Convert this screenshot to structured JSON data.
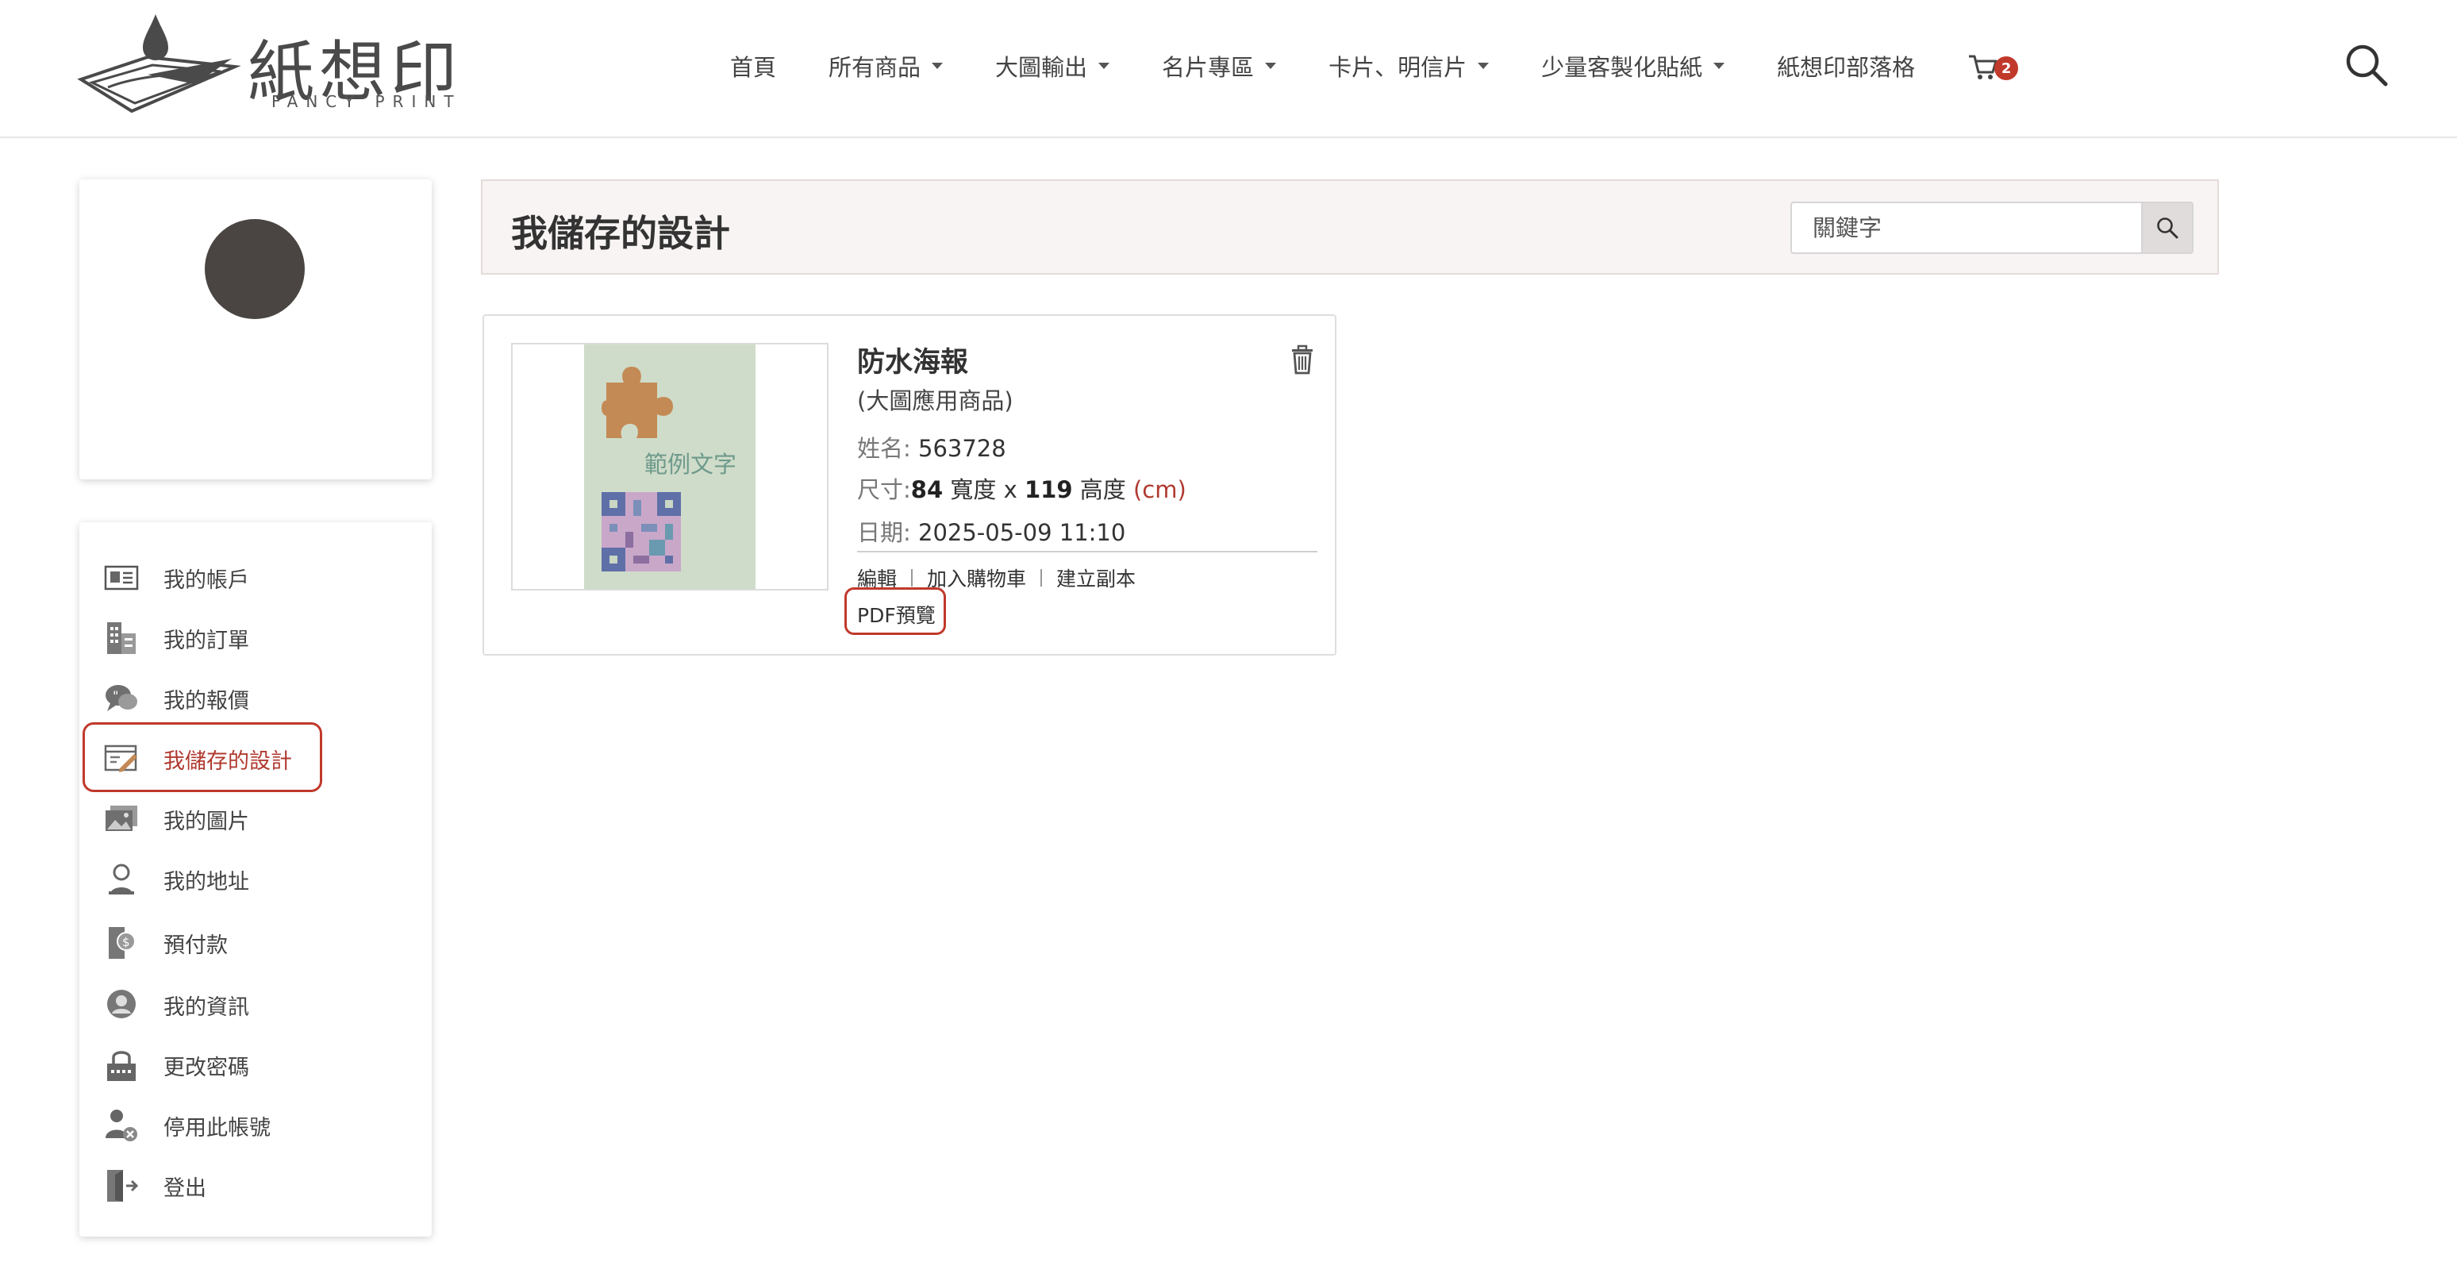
{
  "header": {
    "logo_text": "紙想印",
    "logo_sub": "FANCY PRINT",
    "nav": [
      {
        "label": "首頁",
        "has_caret": false
      },
      {
        "label": "所有商品",
        "has_caret": true
      },
      {
        "label": "大圖輸出",
        "has_caret": true
      },
      {
        "label": "名片專區",
        "has_caret": true
      },
      {
        "label": "卡片、明信片",
        "has_caret": true
      },
      {
        "label": "少量客製化貼紙",
        "has_caret": true
      },
      {
        "label": "紙想印部落格",
        "has_caret": false
      }
    ],
    "cart_count": "2",
    "icons": {
      "cart": "cart-icon",
      "search": "search-icon"
    }
  },
  "sidebar": {
    "items": [
      {
        "label": "我的帳戶",
        "icon": "id-card-icon"
      },
      {
        "label": "我的訂單",
        "icon": "orders-icon"
      },
      {
        "label": "我的報價",
        "icon": "quote-bubble-icon"
      },
      {
        "label": "我儲存的設計",
        "icon": "saved-design-icon",
        "active": true
      },
      {
        "label": "我的圖片",
        "icon": "images-icon"
      },
      {
        "label": "我的地址",
        "icon": "address-icon"
      },
      {
        "label": "預付款",
        "icon": "prepaid-icon"
      },
      {
        "label": "我的資訊",
        "icon": "user-info-icon"
      },
      {
        "label": "更改密碼",
        "icon": "lock-icon"
      },
      {
        "label": "停用此帳號",
        "icon": "disable-account-icon"
      },
      {
        "label": "登出",
        "icon": "logout-icon"
      }
    ]
  },
  "main": {
    "title": "我儲存的設計",
    "search": {
      "placeholder": "關鍵字",
      "value": ""
    },
    "designs": [
      {
        "title": "防水海報",
        "category": "(大圖應用商品)",
        "thumb_text": "範例文字",
        "name_label": "姓名:",
        "name_value": "563728",
        "size_label": "尺寸:",
        "width": "84",
        "width_label": "寬度 x",
        "height": "119",
        "height_label": "高度",
        "unit": "(cm)",
        "date_label": "日期:",
        "date_value": "2025-05-09 11:10",
        "actions": [
          "編輯",
          "加入購物車",
          "建立副本"
        ],
        "pdf_label": "PDF預覽"
      }
    ]
  },
  "colors": {
    "accent": "#c0392b",
    "title_bar_bg": "#f7f4f3",
    "avatar": "#4a4542",
    "thumb_bg": "#cfdcc9",
    "puzzle": "#c48a55"
  }
}
